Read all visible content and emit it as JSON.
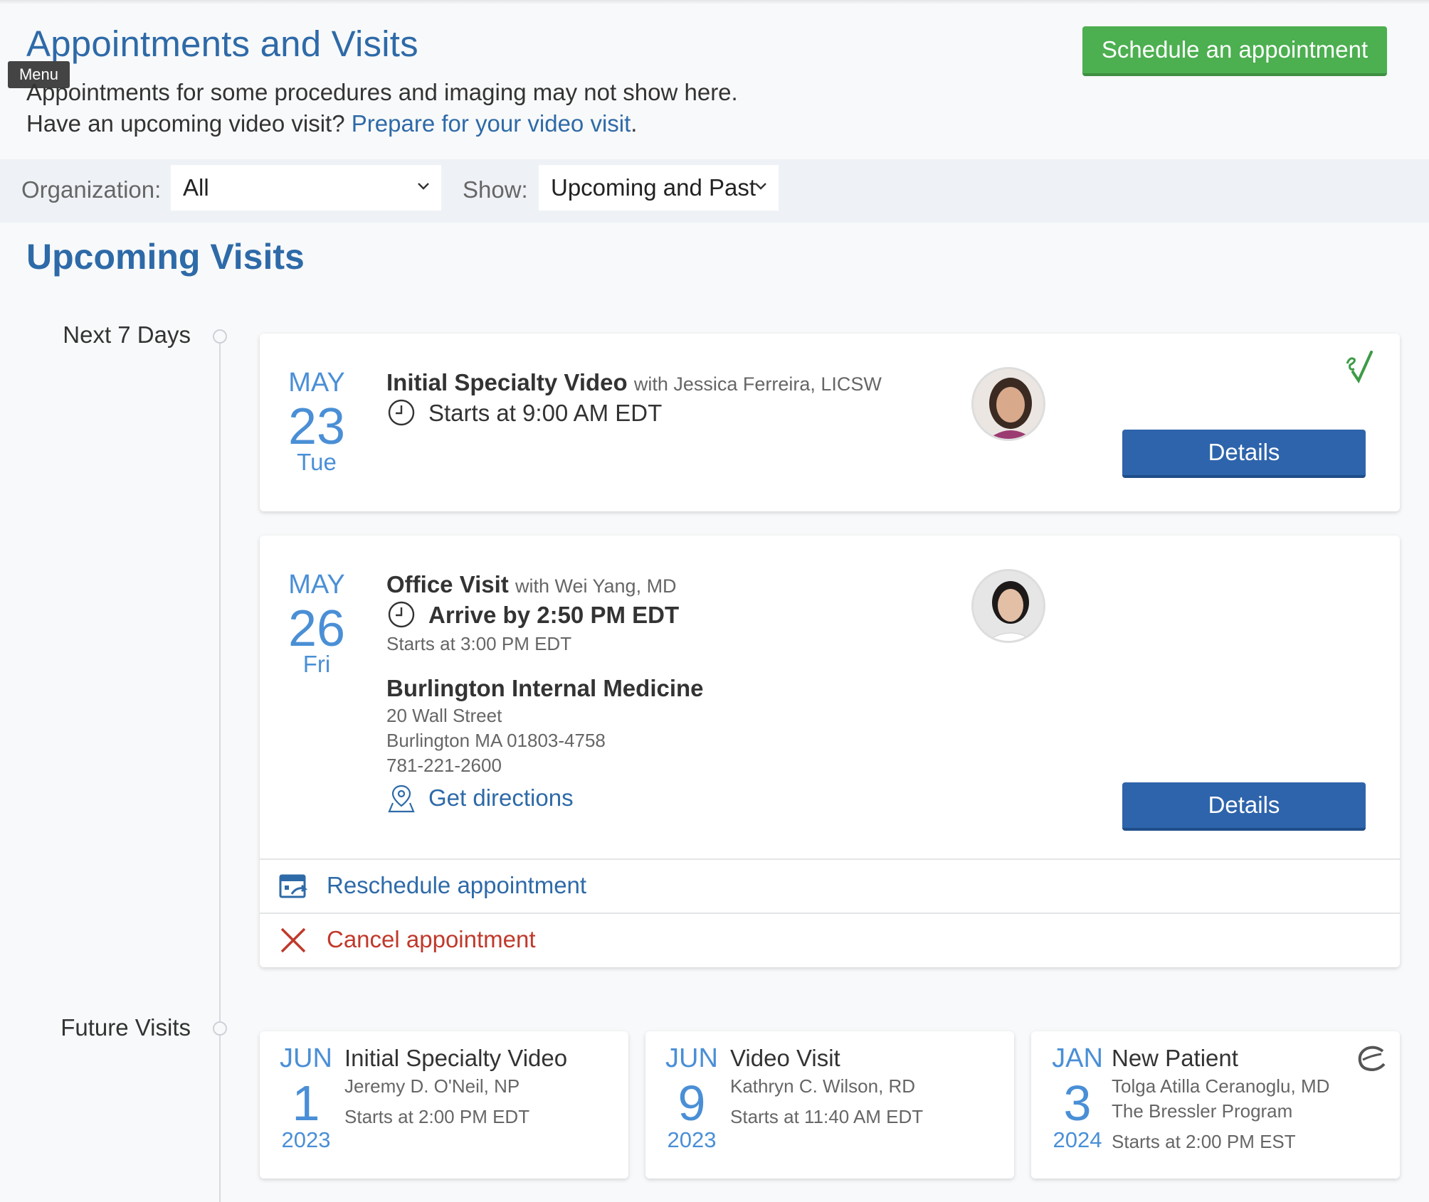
{
  "header": {
    "title": "Appointments and Visits",
    "menu_tooltip": "Menu",
    "notice": "Appointments for some procedures and imaging may not show here.",
    "video_prompt": "Have an upcoming video visit?",
    "video_link": "Prepare for your video visit",
    "video_suffix": ".",
    "schedule_button": "Schedule an appointment"
  },
  "filters": {
    "organization_label": "Organization:",
    "organization_value": "All",
    "show_label": "Show:",
    "show_value": "Upcoming and Past"
  },
  "upcoming": {
    "section_title": "Upcoming Visits",
    "group_label": "Next 7 Days",
    "visits": [
      {
        "month": "MAY",
        "day": "23",
        "weekday": "Tue",
        "title": "Initial Specialty Video",
        "with": "with Jessica Ferreira, LICSW",
        "time": "Starts at 9:00 AM EDT",
        "details_button": "Details",
        "echeckin_icon": "echeckin-checkmark-icon"
      },
      {
        "month": "MAY",
        "day": "26",
        "weekday": "Fri",
        "title": "Office Visit",
        "with": "with Wei Yang, MD",
        "arrive": "Arrive by 2:50 PM EDT",
        "starts": "Starts at 3:00 PM EDT",
        "location_name": "Burlington Internal Medicine",
        "address1": "20 Wall Street",
        "address2": "Burlington MA 01803-4758",
        "phone": "781-221-2600",
        "directions": "Get directions",
        "details_button": "Details",
        "reschedule": "Reschedule appointment",
        "cancel": "Cancel appointment"
      }
    ]
  },
  "future": {
    "group_label": "Future Visits",
    "visits": [
      {
        "month": "JUN",
        "day": "1",
        "year": "2023",
        "title": "Initial Specialty Video",
        "provider": "Jeremy D. O'Neil, NP",
        "time": "Starts at 2:00 PM EDT"
      },
      {
        "month": "JUN",
        "day": "9",
        "year": "2023",
        "title": "Video Visit",
        "provider": "Kathryn C. Wilson, RD",
        "time": "Starts at 11:40 AM EDT"
      },
      {
        "month": "JAN",
        "day": "3",
        "year": "2024",
        "title": "New Patient",
        "provider": "Tolga Atilla Ceranoglu, MD",
        "department": "The Bressler Program",
        "time": "Starts at 2:00 PM EST"
      }
    ]
  },
  "colors": {
    "brand_blue": "#2e6aa8",
    "date_blue": "#4a8fd6",
    "schedule_green": "#4caf50",
    "details_blue": "#2e64ab",
    "cancel_red": "#c0392b"
  }
}
